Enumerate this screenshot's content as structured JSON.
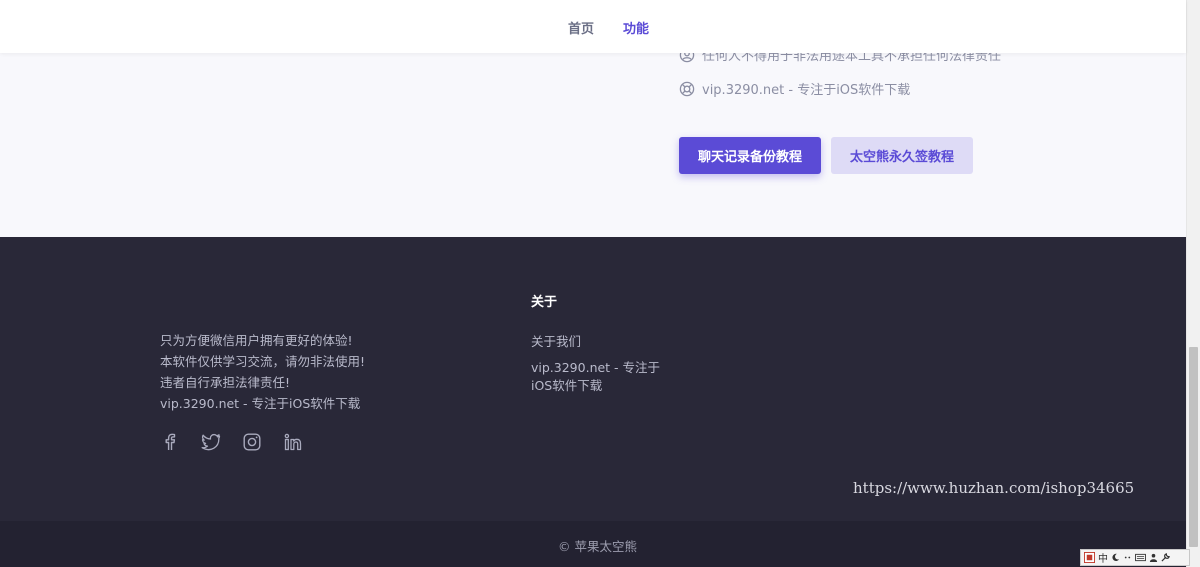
{
  "nav": {
    "home_label": "首页",
    "features_label": "功能"
  },
  "content": {
    "feature_items": [
      {
        "icon": "user-circle-icon",
        "text": "任何人不得用于非法用途本工具不承担任何法律责任"
      },
      {
        "icon": "lifebuoy-icon",
        "text": "vip.3290.net - 专注于iOS软件下载"
      }
    ],
    "buttons": {
      "primary_label": "聊天记录备份教程",
      "secondary_label": "太空熊永久签教程"
    }
  },
  "footer": {
    "description": [
      "只为方便微信用户拥有更好的体验!",
      "本软件仅供学习交流，请勿非法使用!",
      "违者自行承担法律责任!",
      "vip.3290.net - 专注于iOS软件下载"
    ],
    "social_icons": [
      "facebook-icon",
      "twitter-icon",
      "instagram-icon",
      "linkedin-icon"
    ],
    "about": {
      "title": "关于",
      "about_us_label": "关于我们",
      "site_text": "vip.3290.net - 专注于iOS软件下载"
    },
    "watermark": "https://www.huzhan.com/ishop34665",
    "copyright": "© 苹果太空熊"
  },
  "ime_toolbar": {
    "mode_label": "中"
  },
  "colors": {
    "accent": "#5b4bd6",
    "accent_light": "#dedbf6",
    "footer_bg": "#292838",
    "footer_bottom_bg": "#232231",
    "page_bg": "#f8f8fc"
  }
}
